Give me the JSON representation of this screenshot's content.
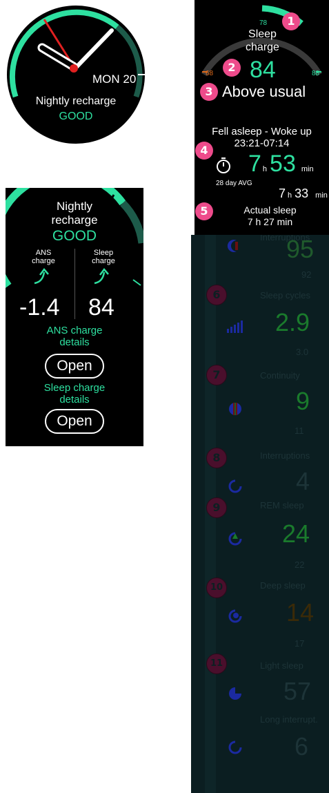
{
  "watch1": {
    "date": "MON 20",
    "title": "Nightly recharge",
    "status": "GOOD"
  },
  "watch2": {
    "title_line1": "Nightly",
    "title_line2": "recharge",
    "status": "GOOD",
    "ans_label_line1": "ANS",
    "ans_label_line2": "charge",
    "sleep_label_line1": "Sleep",
    "sleep_label_line2": "charge",
    "ans_value": "-1.4",
    "sleep_value": "84",
    "ans_details_line1": "ANS charge",
    "ans_details_line2": "details",
    "open_label": "Open",
    "sleep_details_line1": "Sleep charge",
    "sleep_details_line2": "details"
  },
  "sleep_screen": {
    "gauge_top_value": "78",
    "gauge_left_value": "68",
    "gauge_right_value": "88",
    "title_line1": "Sleep",
    "title_line2": "charge",
    "value": "84",
    "comparison": "Above usual",
    "fell_asleep_label": "Fell asleep - Woke up",
    "fell_asleep_time": "23:21-07:14",
    "duration_hours": "7",
    "duration_h_unit": "h",
    "duration_minutes": "53",
    "duration_min_unit": "min",
    "avg_label": "28 day AVG",
    "avg_hours": "7",
    "avg_h_unit": "h",
    "avg_minutes": "33",
    "avg_min_unit": "min",
    "actual_sleep_label": "Actual sleep",
    "actual_sleep_value": "7 h 27 min"
  },
  "badges": [
    "1",
    "2",
    "3",
    "4",
    "5",
    "6",
    "7",
    "8",
    "9",
    "10",
    "11"
  ],
  "dim_list": {
    "values": [
      "95",
      "2.9",
      "9",
      "4",
      "24",
      "14",
      "57",
      "6"
    ],
    "labels": [
      "Interruptions",
      "Sleep cycles",
      "Continuity",
      "Interruptions",
      "REM sleep",
      "Deep sleep",
      "Light sleep",
      "Long interrupt."
    ],
    "subs": [
      "92",
      "3.0",
      "11",
      "22",
      "17"
    ]
  },
  "colors": {
    "accent_green": "#2ee0a0",
    "badge_pink": "#ee4b8b",
    "gauge_orange": "#e06a1a",
    "hand_red": "#e02020",
    "dim_background": "#0b1e21"
  }
}
